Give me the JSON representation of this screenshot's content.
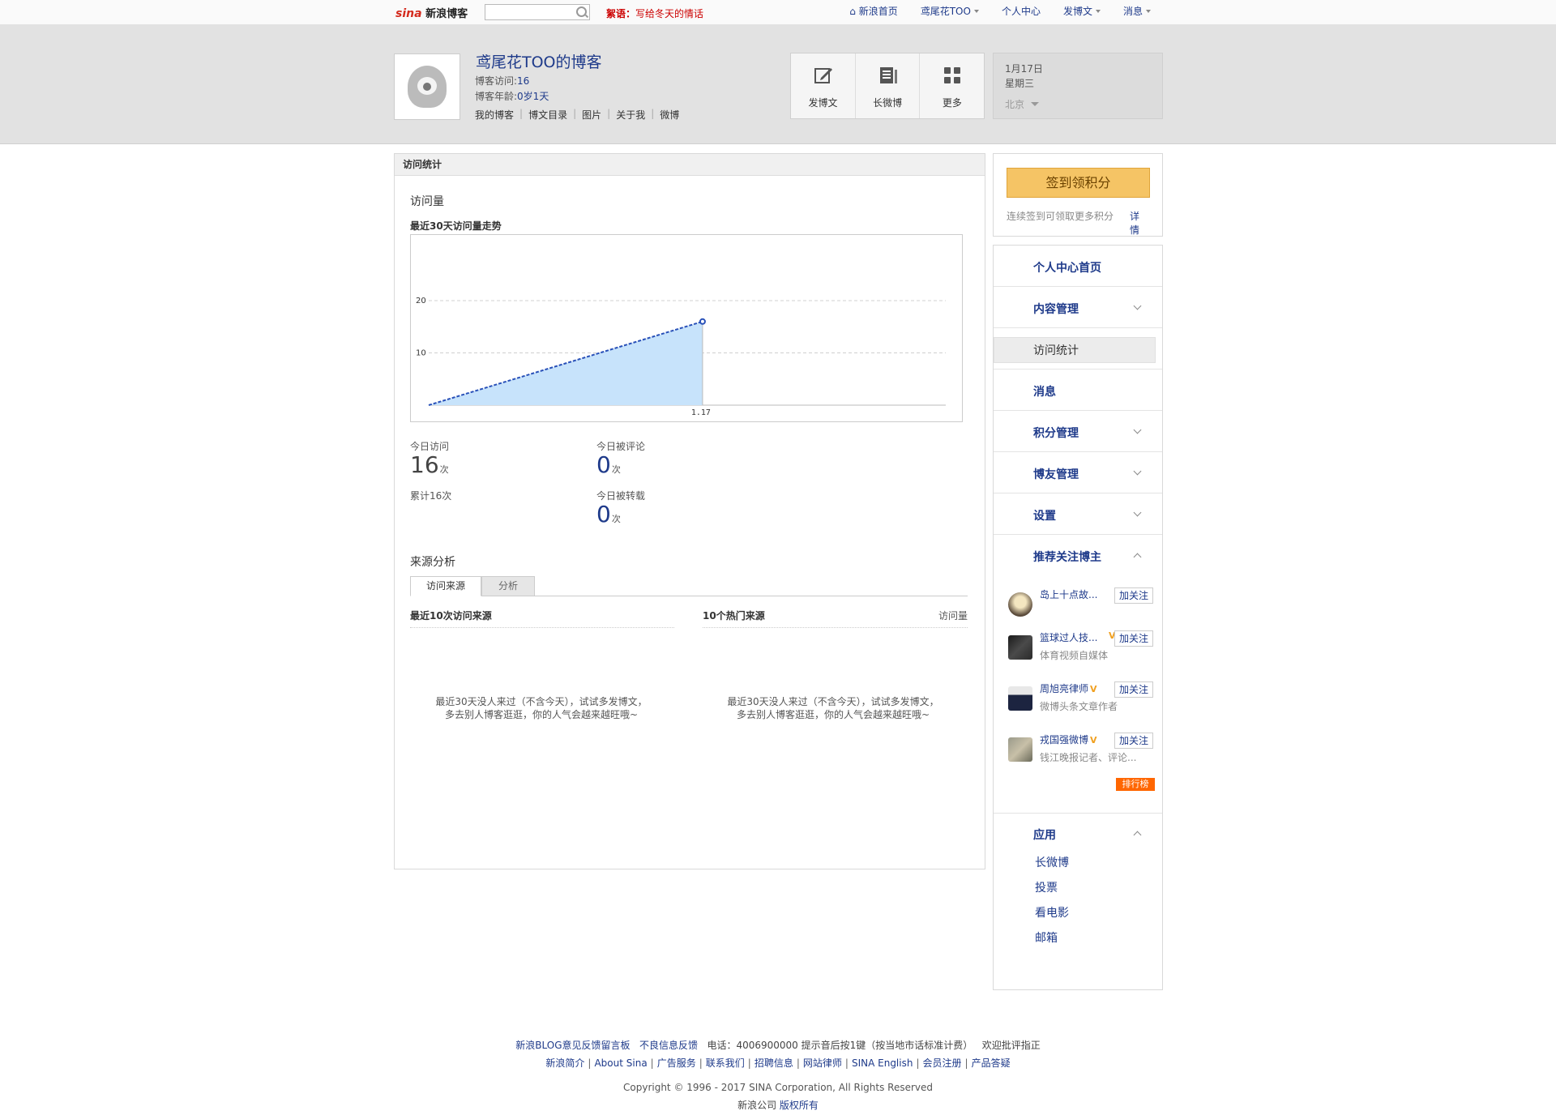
{
  "topbar": {
    "logo_mark": "sina",
    "logo_text": "新浪博客",
    "search_placeholder": "",
    "notice_label": "絮语：",
    "notice_text": "写给冬天的情话",
    "nav": [
      {
        "label": "新浪首页",
        "icon": "home-icon",
        "has_caret": false
      },
      {
        "label": "鸢尾花TOO",
        "icon": "",
        "has_caret": true
      },
      {
        "label": "个人中心",
        "icon": "",
        "has_caret": false
      },
      {
        "label": "发博文",
        "icon": "",
        "has_caret": true
      },
      {
        "label": "消息",
        "icon": "",
        "has_caret": true
      }
    ]
  },
  "header": {
    "blog_title": "鸢尾花TOO的博客",
    "visits_label": "博客访问:",
    "visits_value": "16",
    "age_label": "博客年龄:",
    "age_value": "0岁1天",
    "links": [
      "我的博客",
      "博文目录",
      "图片",
      "关于我",
      "微博"
    ],
    "tools": [
      {
        "label": "发博文",
        "icon": "edit-icon"
      },
      {
        "label": "长微博",
        "icon": "long-weibo-icon"
      },
      {
        "label": "更多",
        "icon": "grid-icon"
      }
    ],
    "date": "1月17日",
    "weekday": "星期三",
    "location": "北京"
  },
  "main": {
    "panel_title": "访问统计",
    "section_visits": "访问量",
    "trend_title": "最近30天访问量走势",
    "stats": {
      "today_visits_label": "今日访问",
      "today_visits_value": "16",
      "total_label": "累计16次",
      "today_comments_label": "今日被评论",
      "today_comments_value": "0",
      "today_reposts_label": "今日被转载",
      "today_reposts_value": "0",
      "unit": "次"
    },
    "section_source": "来源分析",
    "tabs": [
      "访问来源",
      "分析"
    ],
    "recent_sources_title": "最近10次访问来源",
    "hot_sources_title": "10个热门来源",
    "hot_sources_col": "访问量",
    "empty_line1": "最近30天没人来过（不含今天），试试多发博文，",
    "empty_line2": "多去别人博客逛逛，你的人气会越来越旺哦~"
  },
  "chart_data": {
    "type": "area",
    "title": "最近30天访问量走势",
    "x": [
      "",
      "1.17"
    ],
    "x_ticks": [
      "1.17"
    ],
    "values": [
      0,
      16
    ],
    "y_ticks": [
      10,
      20
    ],
    "ylim": [
      0,
      31
    ],
    "grid": "horizontal dashed",
    "line_color": "#2850b8",
    "fill_color": "#c7e3fb"
  },
  "side": {
    "sign_button": "签到领积分",
    "sign_note": "连续签到可领取更多积分",
    "sign_detail": "详情",
    "menu": [
      {
        "label": "个人中心首页",
        "chevron": "none",
        "active": false
      },
      {
        "label": "内容管理",
        "chevron": "down",
        "active": false
      },
      {
        "label": "访问统计",
        "chevron": "none",
        "active": true
      },
      {
        "label": "消息",
        "chevron": "none",
        "active": false
      },
      {
        "label": "积分管理",
        "chevron": "down",
        "active": false
      },
      {
        "label": "博友管理",
        "chevron": "down",
        "active": false
      },
      {
        "label": "设置",
        "chevron": "down",
        "active": false
      },
      {
        "label": "推荐关注博主",
        "chevron": "up",
        "active": false
      }
    ],
    "recommend": [
      {
        "name": "岛上十点故...",
        "desc": "",
        "verified": false,
        "follow": "加关注"
      },
      {
        "name": "篮球过人技...",
        "desc": "体育视频自媒体",
        "verified": true,
        "follow": "加关注"
      },
      {
        "name": "周旭亮律师",
        "desc": "微博头条文章作者",
        "verified": true,
        "follow": "加关注"
      },
      {
        "name": "戎国强微博",
        "desc": "钱江晚报记者、评论...",
        "verified": true,
        "follow": "加关注"
      }
    ],
    "rank_badge": "排行榜",
    "apps_title": "应用",
    "apps": [
      "长微博",
      "投票",
      "看电影",
      "邮箱"
    ]
  },
  "footer": {
    "row1": [
      "新浪BLOG意见反馈留言板",
      "不良信息反馈",
      "电话：4006900000 提示音后按1键（按当地市话标准计费）",
      "欢迎批评指正"
    ],
    "row2": [
      "新浪简介",
      "About Sina",
      "广告服务",
      "联系我们",
      "招聘信息",
      "网站律师",
      "SINA English",
      "会员注册",
      "产品答疑"
    ],
    "copyright": "Copyright © 1996 - 2017 SINA Corporation, All Rights Reserved",
    "company": "新浪公司",
    "rights": "版权所有"
  },
  "colors": {
    "link": "#1e3a8a",
    "accent_orange": "#f5c465",
    "notice_red": "#cc0000",
    "rank_orange": "#ff6600"
  }
}
